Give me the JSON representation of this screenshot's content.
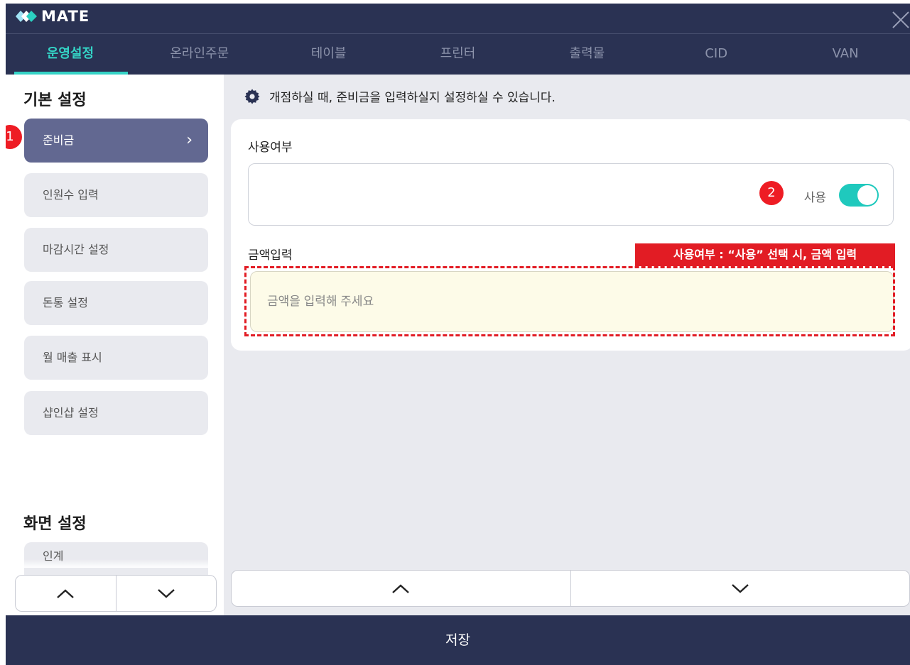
{
  "app": {
    "logo_text": "MATE"
  },
  "tabs": [
    {
      "label": "운영설정",
      "active": true
    },
    {
      "label": "온라인주문"
    },
    {
      "label": "테이블"
    },
    {
      "label": "프린터"
    },
    {
      "label": "출력물"
    },
    {
      "label": "CID"
    },
    {
      "label": "VAN"
    }
  ],
  "sidebar": {
    "section_basic": "기본 설정",
    "items": [
      {
        "label": "준비금",
        "active": true
      },
      {
        "label": "인원수 입력"
      },
      {
        "label": "마감시간 설정"
      },
      {
        "label": "돈통 설정"
      },
      {
        "label": "월 매출 표시"
      },
      {
        "label": "샵인샵 설정"
      }
    ],
    "section_screen": "화면 설정",
    "screen_items": [
      {
        "label": "인계"
      }
    ]
  },
  "main": {
    "info_text": "개점하실 때, 준비금을 입력하실지 설정하실 수 있습니다.",
    "use_label": "사용여부",
    "toggle_text": "사용",
    "toggle_on": true,
    "amount_label": "금액입력",
    "amount_placeholder": "금액을 입력해 주세요",
    "amount_value": ""
  },
  "annotations": {
    "badge1": "1",
    "badge2": "2",
    "note": "사용여부 : “사용” 선택 시, 금액 입력"
  },
  "footer": {
    "save_label": "저장"
  },
  "colors": {
    "header": "#2a3253",
    "accent": "#34d3c6",
    "toggle": "#1fc9bd",
    "active_item": "#626891",
    "annotation_red": "#e21c24"
  }
}
